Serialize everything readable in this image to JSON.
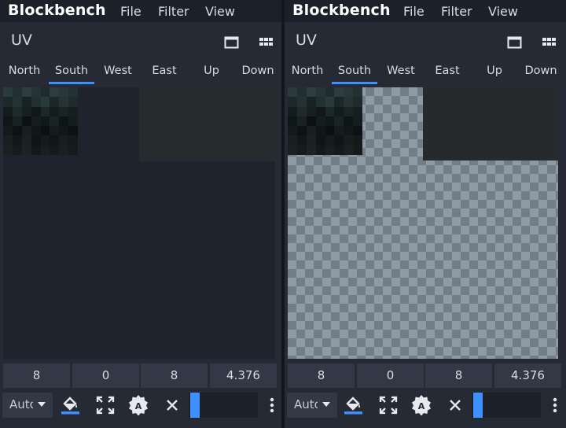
{
  "panels": [
    {
      "app_name": "Blockbench",
      "menu": [
        "File",
        "Filter",
        "View"
      ],
      "uv_title": "UV",
      "tabs": [
        "North",
        "South",
        "West",
        "East",
        "Up",
        "Down"
      ],
      "active_tab": "South",
      "transparent_background_shown": false,
      "uv_values": [
        "8",
        "0",
        "8",
        "4.376"
      ],
      "size_select": "Auto",
      "slider_value": 0.1
    },
    {
      "app_name": "Blockbench",
      "menu": [
        "File",
        "Filter",
        "View"
      ],
      "uv_title": "UV",
      "tabs": [
        "North",
        "South",
        "West",
        "East",
        "Up",
        "Down"
      ],
      "active_tab": "South",
      "transparent_background_shown": true,
      "uv_values": [
        "8",
        "0",
        "8",
        "4.376"
      ],
      "size_select": "Auto",
      "slider_value": 0.1
    }
  ],
  "icons": {
    "maximize": "window-maximize-icon",
    "grid": "grid-icon",
    "fill": "paint-bucket-icon",
    "maximize_uv": "expand-icon",
    "auto_uv": "auto-uv-badge-icon",
    "clear": "close-icon",
    "more": "more-vertical-icon"
  },
  "colors": {
    "accent": "#3e90ff",
    "panel_bg": "#252a35",
    "menubar_bg": "#1c2029",
    "input_bg": "#323845",
    "checker_light": "#8e9aa4",
    "checker_dark": "#727d88",
    "text": "#d6dbe4"
  },
  "texture_palette": [
    [
      "#2a3a3d",
      "#203032",
      "#2d3d3f",
      "#253537",
      "#1f2c2d",
      "#2e3c3d",
      "#28383a",
      "#223132"
    ],
    [
      "#1c2829",
      "#243234",
      "#172223",
      "#223031",
      "#2a393a",
      "#1a2627",
      "#253334",
      "#1e2a2b"
    ],
    [
      "#141c1d",
      "#1f2a2b",
      "#162021",
      "#101819",
      "#1d2829",
      "#131b1c",
      "#1a2425",
      "#161f20"
    ],
    [
      "#0f1617",
      "#182223",
      "#0c1213",
      "#151e1f",
      "#111819",
      "#1a2324",
      "#0e1516",
      "#141d1e"
    ],
    [
      "#121a1b",
      "#0d1314",
      "#172021",
      "#101718",
      "#0b1112",
      "#141c1d",
      "#111819",
      "#0c1213"
    ],
    [
      "#181f20",
      "#121819",
      "#1a2122",
      "#0f1415",
      "#151b1c",
      "#101617",
      "#171e1f",
      "#131a1b"
    ],
    [
      "#1b2021",
      "#161b1c",
      "#1d2324",
      "#13191a",
      "#191f20",
      "#14191a",
      "#1a2021",
      "#151a1b"
    ]
  ]
}
